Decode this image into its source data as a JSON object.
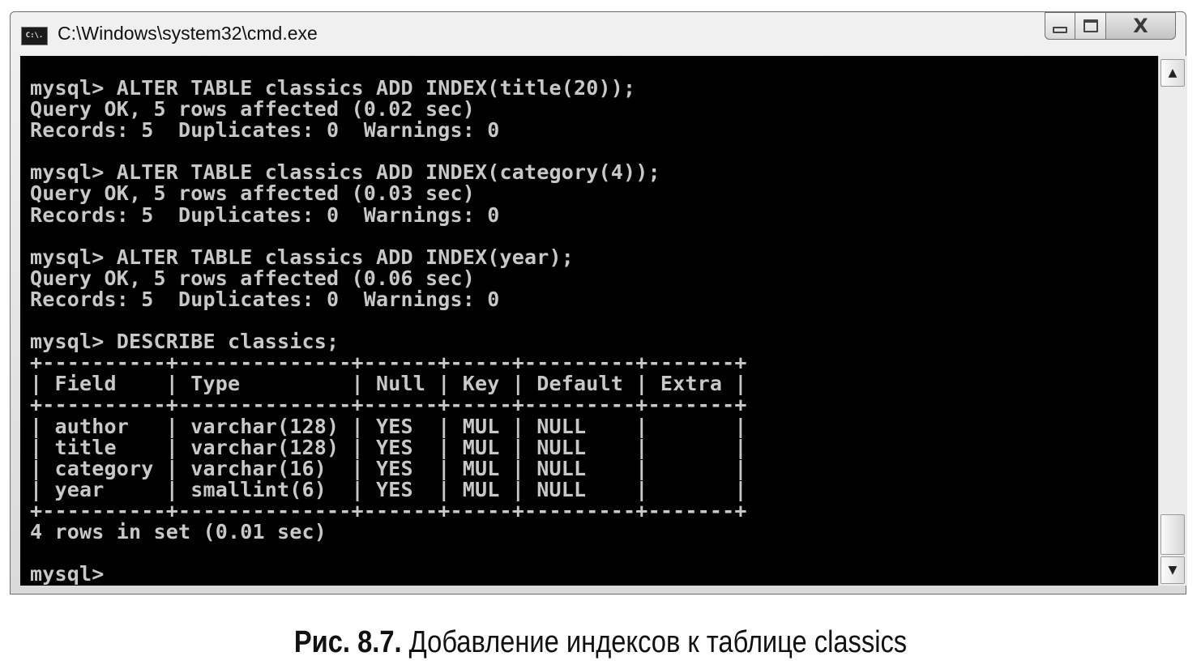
{
  "window": {
    "title": "C:\\Windows\\system32\\cmd.exe",
    "icon_label": "C:\\.",
    "icon": "command-prompt-icon",
    "controls": {
      "minimize_icon": "minimize-icon",
      "maximize_icon": "maximize-icon",
      "close_icon": "close-icon",
      "close_glyph": "X"
    }
  },
  "console": {
    "background": "#000000",
    "foreground": "#c8c8c8",
    "lines": [
      "mysql> ALTER TABLE classics ADD INDEX(title(20));",
      "Query OK, 5 rows affected (0.02 sec)",
      "Records: 5  Duplicates: 0  Warnings: 0",
      "",
      "mysql> ALTER TABLE classics ADD INDEX(category(4));",
      "Query OK, 5 rows affected (0.03 sec)",
      "Records: 5  Duplicates: 0  Warnings: 0",
      "",
      "mysql> ALTER TABLE classics ADD INDEX(year);",
      "Query OK, 5 rows affected (0.06 sec)",
      "Records: 5  Duplicates: 0  Warnings: 0",
      "",
      "mysql> DESCRIBE classics;",
      "+----------+--------------+------+-----+---------+-------+",
      "| Field    | Type         | Null | Key | Default | Extra |",
      "+----------+--------------+------+-----+---------+-------+",
      "| author   | varchar(128) | YES  | MUL | NULL    |       |",
      "| title    | varchar(128) | YES  | MUL | NULL    |       |",
      "| category | varchar(16)  | YES  | MUL | NULL    |       |",
      "| year     | smallint(6)  | YES  | MUL | NULL    |       |",
      "+----------+--------------+------+-----+---------+-------+",
      "4 rows in set (0.01 sec)",
      "",
      "mysql>"
    ]
  },
  "scrollbar": {
    "up_icon": "scroll-up-arrow-icon",
    "down_icon": "scroll-down-arrow-icon",
    "up_glyph": "▲",
    "down_glyph": "▼"
  },
  "caption": {
    "label": "Рис. 8.7.",
    "text": " Добавление индексов к таблице classics"
  }
}
